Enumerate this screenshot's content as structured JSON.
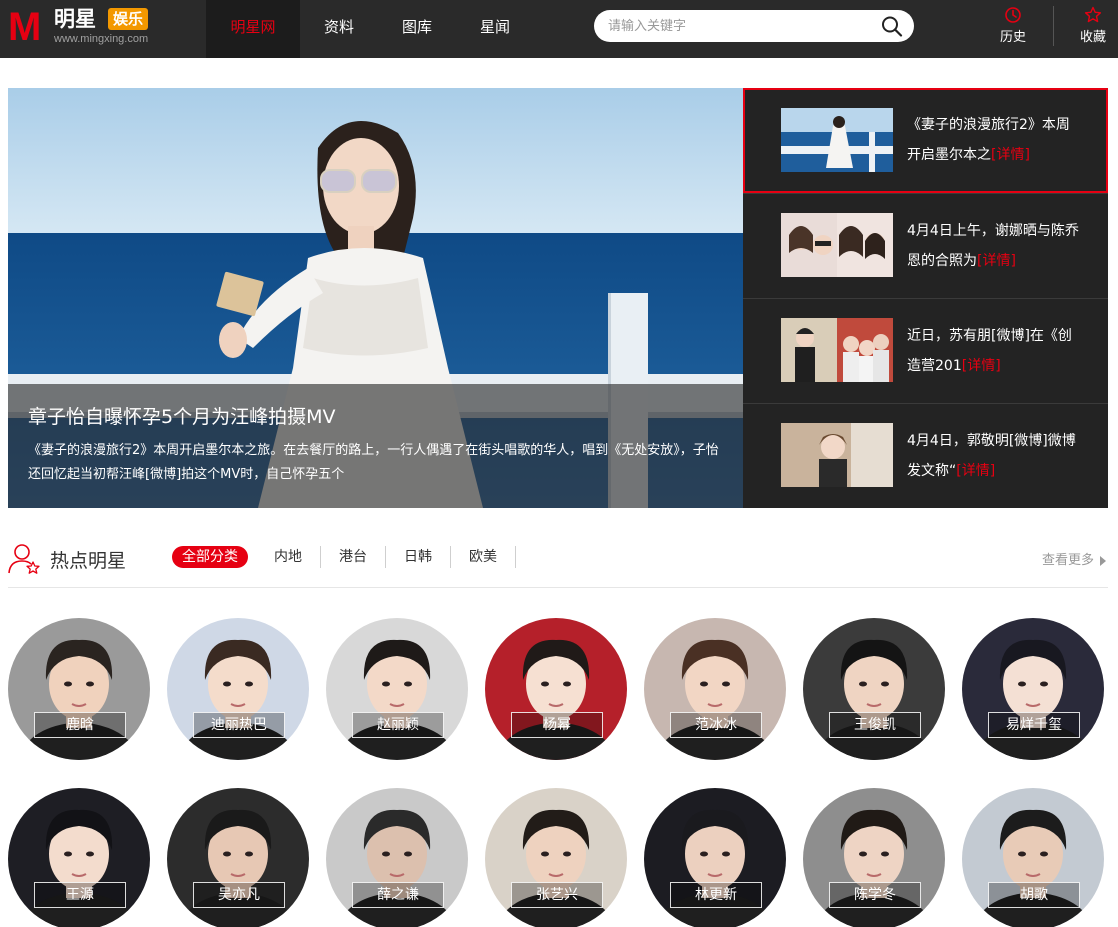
{
  "header": {
    "logo_letter": "M",
    "logo_name": "明星",
    "logo_badge": "娱乐",
    "logo_url": "www.mingxing.com",
    "nav": [
      {
        "label": "明星网",
        "active": true
      },
      {
        "label": "资料",
        "active": false
      },
      {
        "label": "图库",
        "active": false
      },
      {
        "label": "星闻",
        "active": false
      }
    ],
    "search_placeholder": "请输入关键字",
    "history_label": "历史",
    "favorites_label": "收藏"
  },
  "hero": {
    "title": "章子怡自曝怀孕5个月为汪峰拍摄MV",
    "summary": "《妻子的浪漫旅行2》本周开启墨尔本之旅。在去餐厅的路上，一行人偶遇了在街头唱歌的华人，唱到《无处安放》，子怡还回忆起当初帮汪峰[微博]拍这个MV时，自己怀孕五个"
  },
  "side_list": [
    {
      "text": "《妻子的浪漫旅行2》本周开启墨尔本之",
      "more": "[详情]",
      "active": true
    },
    {
      "text": "4月4日上午，谢娜晒与陈乔恩的合照为",
      "more": "[详情]",
      "active": false
    },
    {
      "text": "近日，苏有朋[微博]在《创造营201",
      "more": "[详情]",
      "active": false
    },
    {
      "text": "4月4日，郭敬明[微博]微博发文称“",
      "more": "[详情]",
      "active": false
    }
  ],
  "hot_stars": {
    "title": "热点明星",
    "filters": [
      "全部分类",
      "内地",
      "港台",
      "日韩",
      "欧美"
    ],
    "active_filter": "全部分类",
    "see_more": "查看更多",
    "stars": [
      {
        "name": "鹿晗",
        "bg": "#9a9a9a",
        "skin": "#f0d2bd",
        "hair": "#2a2420"
      },
      {
        "name": "迪丽热巴",
        "bg": "#cfd8e6",
        "skin": "#f4dccb",
        "hair": "#3a2a22"
      },
      {
        "name": "赵丽颖",
        "bg": "#d8d8d8",
        "skin": "#f3d9c8",
        "hair": "#1e1a18"
      },
      {
        "name": "杨幂",
        "bg": "#b5202a",
        "skin": "#f6e0d2",
        "hair": "#201a18"
      },
      {
        "name": "范冰冰",
        "bg": "#c7b7b0",
        "skin": "#f2d6c4",
        "hair": "#4a3024"
      },
      {
        "name": "王俊凯",
        "bg": "#3b3b3b",
        "skin": "#efd4c2",
        "hair": "#141414"
      },
      {
        "name": "易烊千玺",
        "bg": "#2a2a3a",
        "skin": "#f4e0d4",
        "hair": "#181820"
      },
      {
        "name": "王源",
        "bg": "#1e1e24",
        "skin": "#f3dccd",
        "hair": "#121216"
      },
      {
        "name": "吴亦凡",
        "bg": "#2c2c2c",
        "skin": "#e7c8b4",
        "hair": "#1a1a1a"
      },
      {
        "name": "薛之谦",
        "bg": "#c9c9c9",
        "skin": "#dcc0ae",
        "hair": "#2a2a2a"
      },
      {
        "name": "张艺兴",
        "bg": "#d9d2c8",
        "skin": "#eed2bf",
        "hair": "#221c18"
      },
      {
        "name": "林更新",
        "bg": "#1c1c22",
        "skin": "#ecd0bf",
        "hair": "#1a1a1e"
      },
      {
        "name": "陈学冬",
        "bg": "#8e8e8e",
        "skin": "#eed4c4",
        "hair": "#201a16"
      },
      {
        "name": "胡歌",
        "bg": "#c3cad2",
        "skin": "#e8cbb7",
        "hair": "#1c1c1c"
      }
    ]
  },
  "colors": {
    "accent": "#e60012",
    "header_bg": "#2a2a2a",
    "side_bg": "#232323",
    "logo_badge": "#f39800"
  }
}
